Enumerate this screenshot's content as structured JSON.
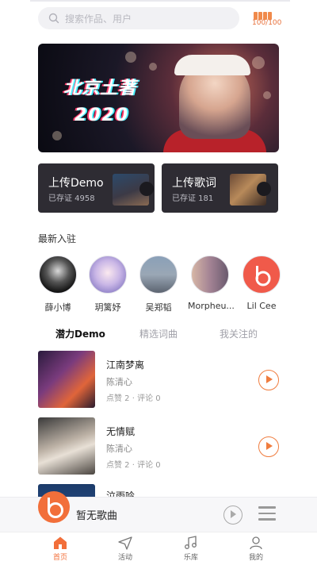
{
  "search": {
    "placeholder": "搜索作品、用户"
  },
  "status": {
    "level_text": "100/100"
  },
  "banner": {
    "line1": "北京土著",
    "line2": "2020",
    "active_dot": 0,
    "dot_count": 7
  },
  "cards": [
    {
      "title": "上传Demo",
      "subtitle": "已存证 4958"
    },
    {
      "title": "上传歌词",
      "subtitle": "已存证 181"
    }
  ],
  "latest": {
    "title": "最新入驻"
  },
  "artists": [
    {
      "name": "薛小博"
    },
    {
      "name": "玥篱妤"
    },
    {
      "name": "吴郑韬"
    },
    {
      "name": "Morpheu..."
    },
    {
      "name": "Lil Cee"
    }
  ],
  "tabs": [
    {
      "label": "潜力Demo",
      "active": true
    },
    {
      "label": "精选词曲",
      "active": false
    },
    {
      "label": "我关注的",
      "active": false
    }
  ],
  "songs": [
    {
      "title": "江南梦离",
      "artist": "陈清心",
      "meta": "点赞 2 · 评论 0"
    },
    {
      "title": "无情赋",
      "artist": "陈清心",
      "meta": "点赞 2 · 评论 0"
    },
    {
      "title": "泣雨吟",
      "artist": "",
      "meta": ""
    }
  ],
  "player": {
    "now_playing": "暂无歌曲"
  },
  "nav": [
    {
      "label": "首页",
      "icon": "home-icon",
      "active": true
    },
    {
      "label": "活动",
      "icon": "send-icon",
      "active": false
    },
    {
      "label": "乐库",
      "icon": "music-note-icon",
      "active": false
    },
    {
      "label": "我的",
      "icon": "user-icon",
      "active": false
    }
  ],
  "colors": {
    "accent": "#f26f3a",
    "card_bg": "#2e2c33"
  }
}
